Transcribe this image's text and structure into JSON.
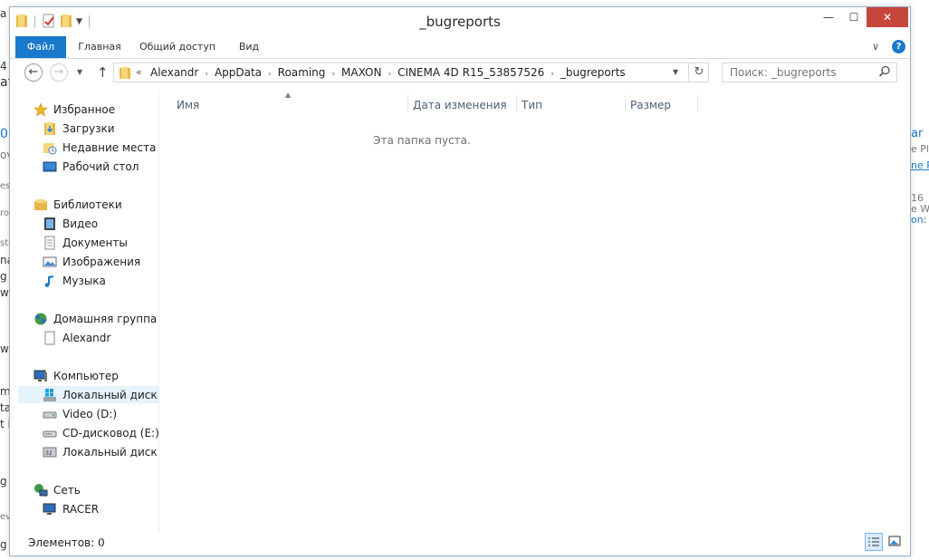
{
  "window": {
    "title": "_bugreports",
    "minimize_glyph": "—",
    "maximize_glyph": "☐",
    "close_glyph": "✕"
  },
  "ribbon": {
    "tabs": [
      "Файл",
      "Главная",
      "Общий доступ",
      "Вид"
    ],
    "expand_glyph": "∨",
    "help_glyph": "?"
  },
  "navigation": {
    "back_glyph": "←",
    "forward_glyph": "→",
    "up_glyph": "↑",
    "refresh_glyph": "↻"
  },
  "address": {
    "overflow": "«",
    "crumbs": [
      "Alexandr",
      "AppData",
      "Roaming",
      "MAXON",
      "CINEMA 4D R15_53857526",
      "_bugreports"
    ]
  },
  "search": {
    "placeholder": "Поиск: _bugreports"
  },
  "nav_pane": {
    "favorites": {
      "label": "Избранное",
      "icon": "star-icon",
      "items": [
        "Загрузки",
        "Недавние места",
        "Рабочий стол"
      ]
    },
    "libraries": {
      "label": "Библиотеки",
      "icon": "library-icon",
      "items": [
        "Видео",
        "Документы",
        "Изображения",
        "Музыка"
      ]
    },
    "homegroup": {
      "label": "Домашняя группа",
      "icon": "homegroup-icon",
      "items": [
        "Alexandr"
      ]
    },
    "computer": {
      "label": "Компьютер",
      "icon": "computer-icon",
      "items": [
        "Локальный диск (C",
        "Video (D:)",
        "CD-дисковод (E:) HI",
        "Локальный диск (H"
      ],
      "selected_index": 0
    },
    "network": {
      "label": "Сеть",
      "icon": "network-icon",
      "items": [
        "RACER"
      ]
    }
  },
  "columns": [
    "Имя",
    "Дата изменения",
    "Тип",
    "Размер"
  ],
  "content": {
    "empty_message": "Эта папка пуста."
  },
  "status": {
    "text": "Элементов: 0"
  },
  "background": {
    "left_fragments": [
      "a P",
      "4",
      "at",
      "0",
      "ov",
      "es",
      "rot",
      "ste",
      "na",
      "g",
      "w",
      "w",
      "ma",
      "ta",
      "t is",
      "g",
      "ev",
      "g"
    ],
    "right_fragments": [
      "ar",
      "e Pl",
      "ne P",
      "16",
      "e W",
      "on:"
    ]
  },
  "colors": {
    "accent": "#1979ca",
    "close_button": "#c7463b",
    "header_text": "#4c607a",
    "selection": "#e5f3fb"
  }
}
